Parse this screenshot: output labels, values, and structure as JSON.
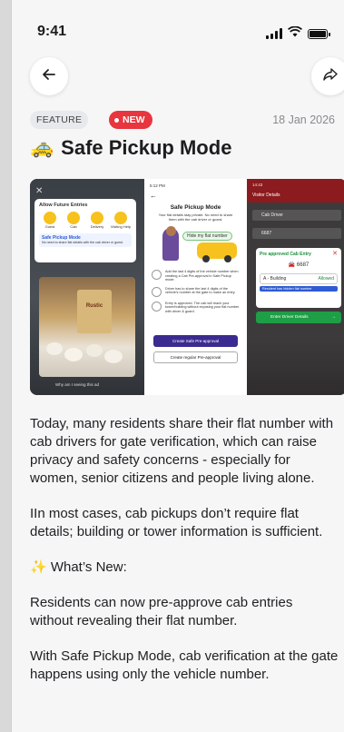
{
  "status_bar": {
    "time": "9:41"
  },
  "header": {
    "back_icon": "arrow-left-icon",
    "share_icon": "share-arrow-icon"
  },
  "article": {
    "tag": "FEATURE",
    "new_badge": "NEW",
    "date": "18 Jan 2026",
    "title_emoji": "🚕",
    "title": "Safe Pickup Mode",
    "paragraphs": [
      "Today, many residents share their flat number with cab drivers for gate verification, which can raise privacy and safety concerns - especially for women, senior citizens and people living alone.",
      "IIn most cases, cab pickups don’t require flat details; building or tower information is sufficient.",
      "✨ What’s New:",
      "Residents can now pre-approve cab entries without revealing their flat number.",
      "With Safe Pickup Mode, cab verification at the gate happens using only the vehicle number."
    ]
  },
  "hero_image": {
    "panel1": {
      "card_title": "Allow Future Entries",
      "chips": [
        "Guest",
        "Cab",
        "Delivery",
        "Visiting Help"
      ],
      "safe_label": "Safe Pickup Mode",
      "safe_desc": "No need to share flat details with the cab driver or guest.",
      "product_name": "Rustic",
      "footer": "Why am I seeing this ad"
    },
    "panel2": {
      "time": "5:12 PM",
      "heading": "Safe Pickup Mode",
      "subheading": "Your flat details stay private. No need to share them with the cab driver or guard.",
      "hide_label": "Hide my flat number",
      "steps": [
        "Add the last 4 digits of the vehicle number when creating a Cab Pre-approval in Safe Pickup mode.",
        "Driver has to share the last 4 digits of the vehicle's number at the gate to make an entry.",
        "Entry is approved. The cab will reach your tower/building without exposing your flat number with driver & guard."
      ],
      "primary_btn": "Create Safe Pre-approval",
      "secondary_btn": "Create regular Pre-approval"
    },
    "panel3": {
      "time": "14:43",
      "screen_title": "Visitor Details",
      "field1": "Cab Driver",
      "field2": "6687",
      "popup_title": "Pre approved Cab Entry",
      "vehicle": "6687",
      "building": "A - Building",
      "status": "Allowed",
      "note": "Resident has hidden flat number",
      "button": "Enter Driver Details"
    }
  }
}
